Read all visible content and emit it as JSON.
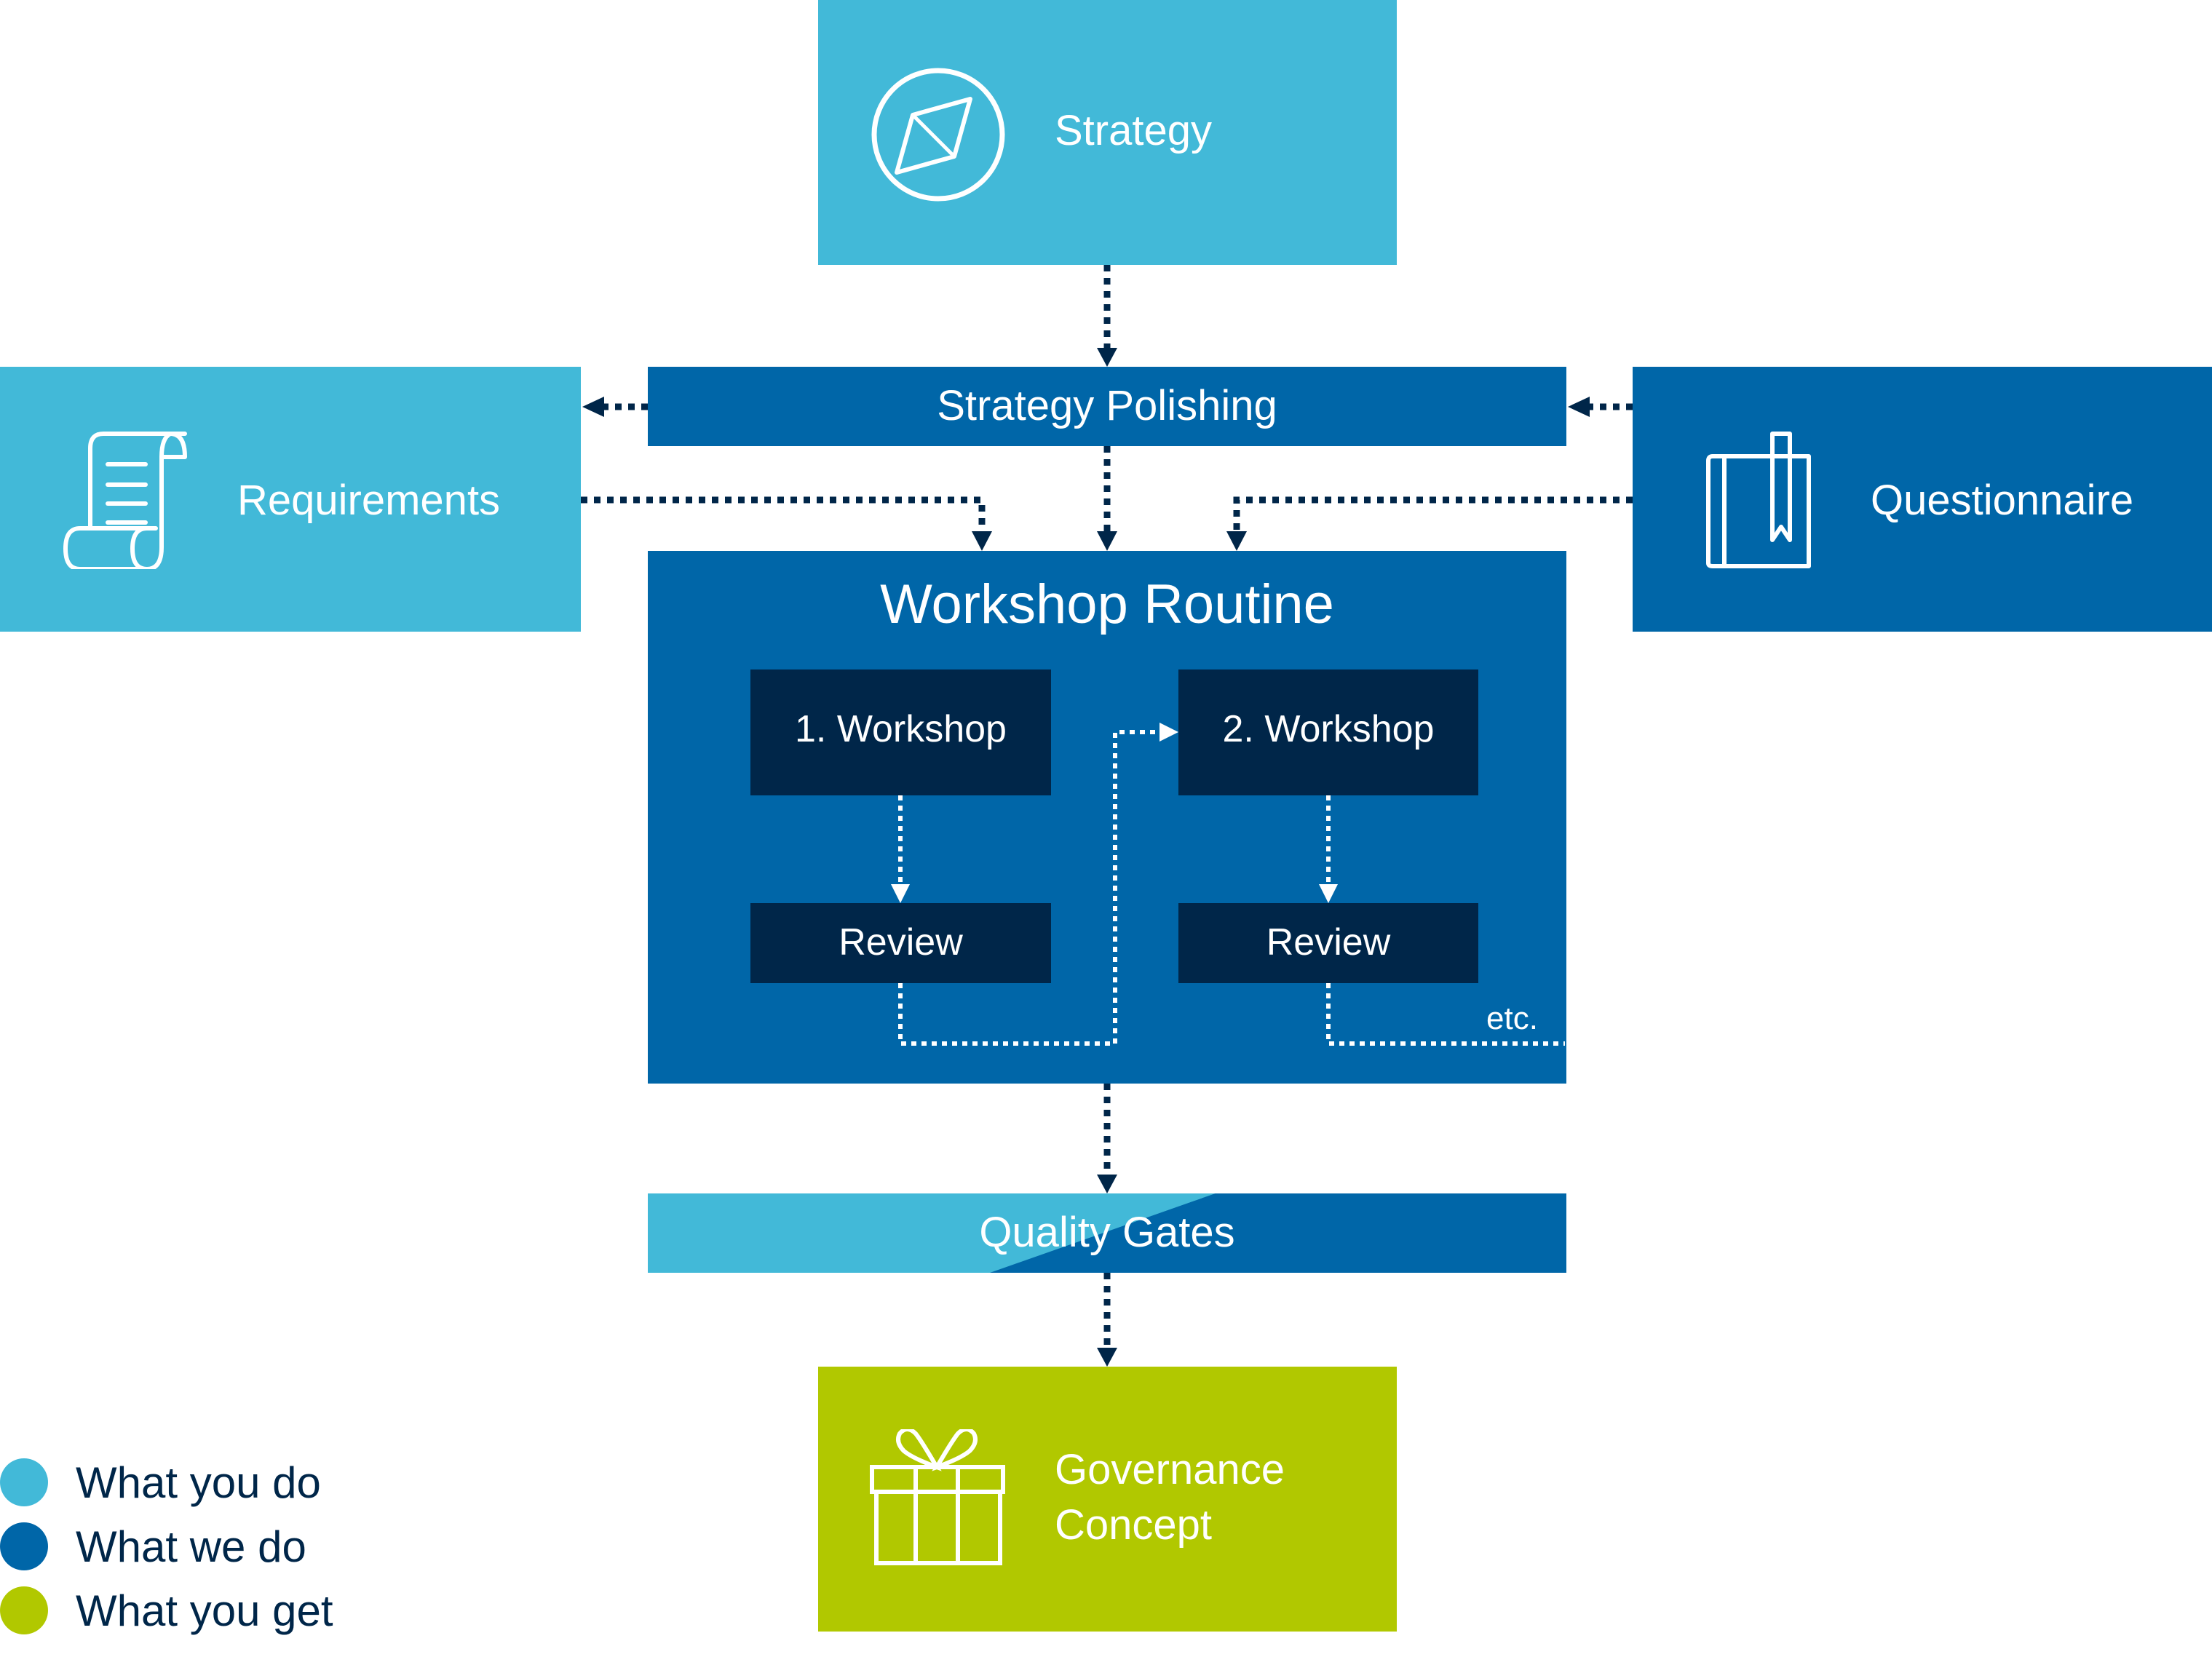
{
  "diagram": {
    "nodes": {
      "strategy": {
        "label": "Strategy",
        "icon": "compass-icon",
        "category": "what_you_do"
      },
      "strategy_polishing": {
        "label": "Strategy Polishing",
        "category": "what_we_do"
      },
      "requirements": {
        "label": "Requirements",
        "icon": "scroll-icon",
        "category": "what_you_do"
      },
      "questionnaire": {
        "label": "Questionnaire",
        "icon": "book-bookmark-icon",
        "category": "what_we_do"
      },
      "workshop_routine": {
        "title": "Workshop Routine",
        "workshop_1": "1. Workshop",
        "review_1": "Review",
        "workshop_2": "2. Workshop",
        "review_2": "Review",
        "etc": "etc."
      },
      "quality_gates": {
        "label": "Quality Gates",
        "category": "what_you_do / what_we_do"
      },
      "governance_concept": {
        "label_line1": "Governance",
        "label_line2": "Concept",
        "icon": "gift-icon",
        "category": "what_you_get"
      }
    },
    "edges": [
      {
        "from": "Strategy",
        "to": "Strategy Polishing"
      },
      {
        "from": "Strategy Polishing",
        "to": "Requirements"
      },
      {
        "from": "Questionnaire",
        "to": "Strategy Polishing"
      },
      {
        "from": "Strategy Polishing",
        "to": "Workshop Routine"
      },
      {
        "from": "Requirements",
        "to": "Workshop Routine"
      },
      {
        "from": "Questionnaire",
        "to": "Workshop Routine"
      },
      {
        "from": "1. Workshop",
        "to": "Review"
      },
      {
        "from": "Review",
        "to": "2. Workshop"
      },
      {
        "from": "2. Workshop",
        "to": "Review"
      },
      {
        "from": "Workshop Routine",
        "to": "Quality Gates"
      },
      {
        "from": "Quality Gates",
        "to": "Governance Concept"
      }
    ]
  },
  "legend": [
    {
      "label": "What you do",
      "color": "#42b9d8"
    },
    {
      "label": "What we do",
      "color": "#0066a8"
    },
    {
      "label": "What you get",
      "color": "#b1c800"
    }
  ],
  "colors": {
    "light_blue": "#42b9d8",
    "dark_blue": "#0066a8",
    "navy": "#002649",
    "green": "#b1c800"
  }
}
